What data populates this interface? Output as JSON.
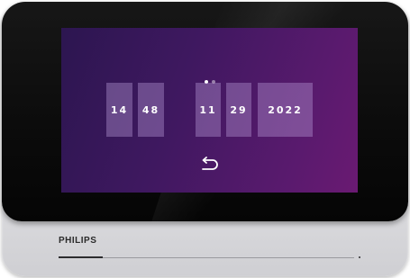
{
  "pager": {
    "active_page": 1,
    "total_pages": 2
  },
  "datetime": {
    "hour": "14",
    "minute": "48",
    "month": "11",
    "day": "29",
    "year": "2022"
  },
  "back_button": {
    "icon": "back-arrow-icon"
  },
  "device": {
    "brand": "PHILIPS",
    "progress_fraction": 0.15
  },
  "colors": {
    "screen_start": "#2c1650",
    "screen_end": "#6a1a72",
    "field_fill": "#bea0dc",
    "text": "#ffffff"
  }
}
